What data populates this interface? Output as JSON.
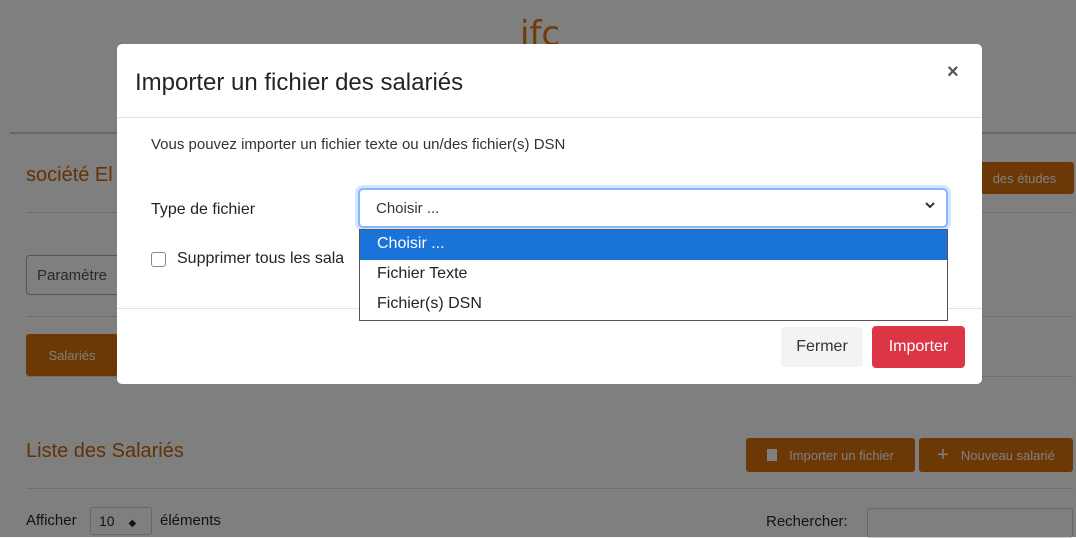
{
  "background": {
    "logo": "ifc",
    "company": "société El",
    "etudes_button": "des études",
    "parametre": "Paramètre",
    "tab_salaries": "Salariés",
    "list_title": "Liste des Salariés",
    "import_button": "Importer un fichier",
    "new_button": "Nouveau salarié",
    "afficher": "Afficher",
    "page_size": "10",
    "elements": "éléments",
    "rechercher": "Rechercher:"
  },
  "modal": {
    "title": "Importer un fichier des salariés",
    "close": "×",
    "intro": "Vous pouvez importer un fichier texte ou un/des fichier(s) DSN",
    "type_label": "Type de fichier",
    "select_value": "Choisir ...",
    "options": [
      "Choisir ...",
      "Fichier Texte",
      "Fichier(s) DSN"
    ],
    "checkbox_label": "Supprimer tous les sala",
    "fermer": "Fermer",
    "importer": "Importer"
  },
  "colors": {
    "accent_orange": "#d9730d",
    "danger": "#dc3545",
    "option_selected": "#1a73d9"
  }
}
